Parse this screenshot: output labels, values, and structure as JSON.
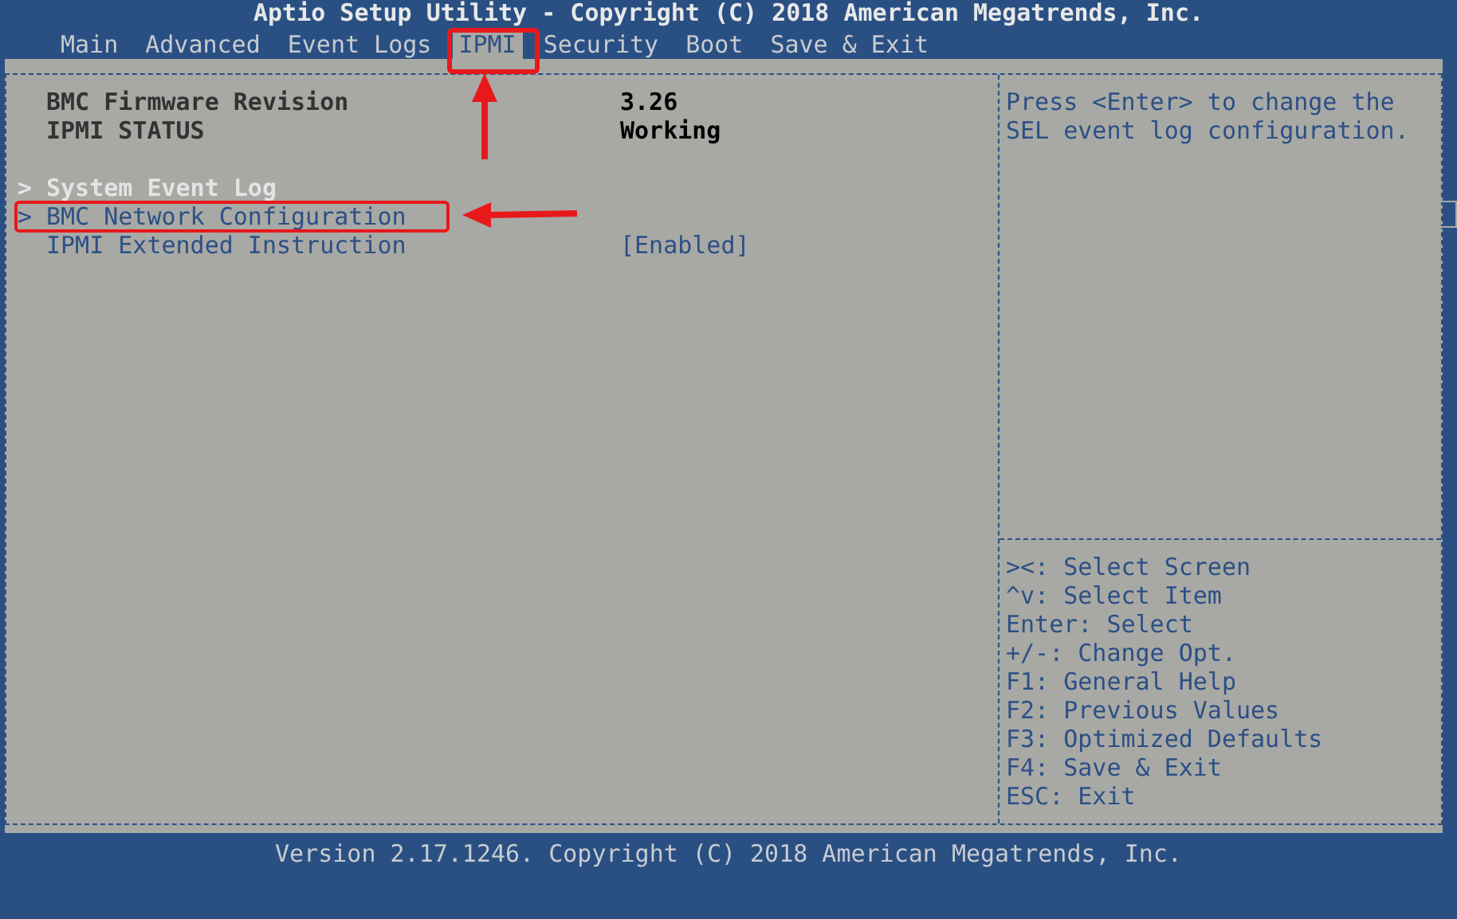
{
  "window": {
    "title": "Aptio Setup Utility - Copyright (C) 2018 American Megatrends, Inc."
  },
  "tabs": [
    {
      "label": "Main",
      "selected": false
    },
    {
      "label": "Advanced",
      "selected": false
    },
    {
      "label": "Event Logs",
      "selected": false
    },
    {
      "label": "IPMI",
      "selected": true
    },
    {
      "label": "Security",
      "selected": false
    },
    {
      "label": "Boot",
      "selected": false
    },
    {
      "label": "Save & Exit",
      "selected": false
    }
  ],
  "info_rows": [
    {
      "label": "BMC Firmware Revision",
      "value": "3.26"
    },
    {
      "label": "IPMI STATUS",
      "value": "Working"
    }
  ],
  "menu_items": [
    {
      "kind": "submenu",
      "marker": ">",
      "label": "System Event Log",
      "selected": true
    },
    {
      "kind": "submenu",
      "marker": ">",
      "label": "BMC Network Configuration",
      "selected": false
    },
    {
      "kind": "setting",
      "label": "IPMI Extended Instruction",
      "value": "[Enabled]",
      "selected": false
    }
  ],
  "help_text": [
    "Press <Enter> to change the",
    "SEL event log configuration."
  ],
  "key_help": [
    "><: Select Screen",
    "^v: Select Item",
    "Enter: Select",
    "+/-: Change Opt.",
    "F1: General Help",
    "F2: Previous Values",
    "F3: Optimized Defaults",
    "F4: Save & Exit",
    "ESC: Exit"
  ],
  "status_bar": "Version 2.17.1246. Copyright (C) 2018 American Megatrends, Inc."
}
